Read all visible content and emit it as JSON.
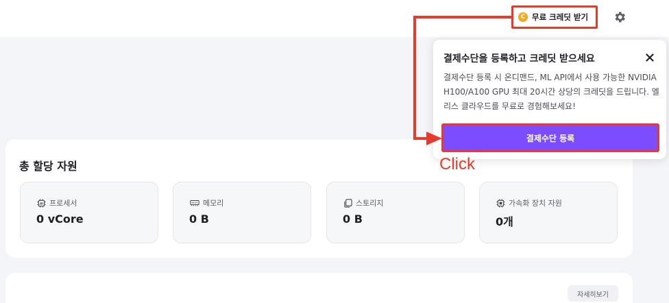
{
  "header": {
    "credit_button_label": "무료 크레딧 받기",
    "coin_symbol": "C"
  },
  "allocation": {
    "title": "총 할당 자원",
    "resources": [
      {
        "label": "프로세서",
        "value": "0 vCore",
        "icon": "cpu-ai-icon"
      },
      {
        "label": "메모리",
        "value": "0 B",
        "icon": "memory-icon"
      },
      {
        "label": "스토리지",
        "value": "0 B",
        "icon": "storage-icon"
      },
      {
        "label": "가속화 장치 자원",
        "value": "0개",
        "icon": "chip-icon"
      }
    ]
  },
  "bottom_card": {
    "detail_button_label": "자세히보기"
  },
  "popover": {
    "title": "결제수단을 등록하고 크레딧 받으세요",
    "body": "결제수단 등록 시 온디맨드, ML API에서 사용 가능한 NVIDIA H100/A100 GPU 최대 20시간 상당의 크레딧을 드립니다. 엘리스 클라우드를 무료로 경험해보세요!",
    "button_label": "결제수단 등록"
  },
  "annotation": {
    "click_label": "Click",
    "color": "#e53b2c"
  },
  "colors": {
    "accent": "#7b4dff",
    "coin": "#f5a623",
    "highlight": "#e53b2c"
  }
}
